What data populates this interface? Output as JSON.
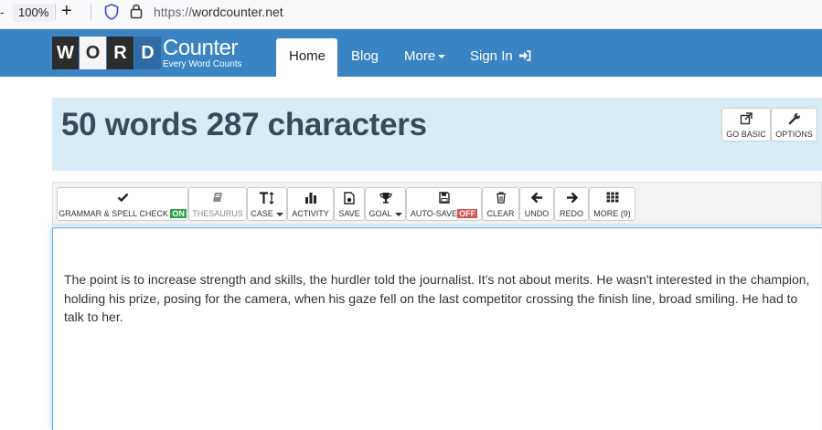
{
  "browser": {
    "zoom": "100%",
    "url_scheme": "https://",
    "url_host": "wordcounter.net"
  },
  "logo": {
    "tiles": [
      "W",
      "O",
      "R",
      "D"
    ],
    "name": "Counter",
    "tagline": "Every Word Counts"
  },
  "nav": {
    "home": "Home",
    "blog": "Blog",
    "more": "More",
    "sign_in": "Sign In"
  },
  "counter": {
    "title": "50 words 287 characters",
    "go_basic": "GO BASIC",
    "options": "OPTIONS"
  },
  "toolbar": {
    "grammar": "GRAMMAR & SPELL CHECK",
    "grammar_badge": "ON",
    "thesaurus": "THESAURUS",
    "case": "CASE",
    "activity": "ACTIVITY",
    "save": "SAVE",
    "goal": "GOAL",
    "autosave": "AUTO-SAVE",
    "autosave_badge": "OFF",
    "clear": "CLEAR",
    "undo": "UNDO",
    "redo": "REDO",
    "more": "MORE (9)"
  },
  "editor": {
    "text": "The point is to increase strength and skills, the hurdler told the journalist. It's not about merits. He wasn't interested in the champion, holding his prize, posing for the camera, when his gaze fell on the last competitor crossing the finish line, broad smiling. He had to talk to her."
  },
  "colors": {
    "nav_bg": "#3a84c4",
    "panel_bg": "#d9ecf6",
    "badge_on": "#2aa34a",
    "badge_off": "#d9534f"
  }
}
